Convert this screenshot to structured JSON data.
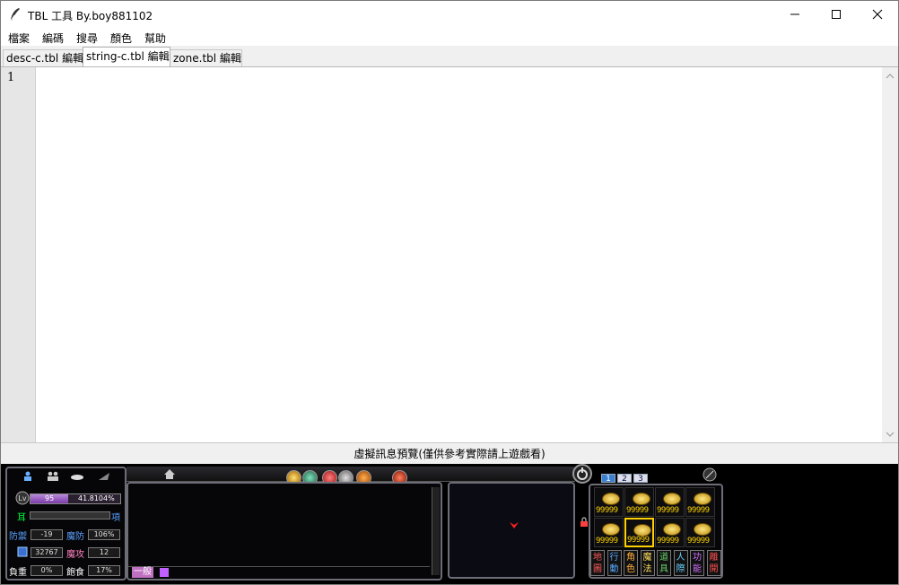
{
  "window": {
    "title": "TBL 工具 By.boy881102"
  },
  "menu": {
    "items": [
      "檔案",
      "編碼",
      "搜尋",
      "顏色",
      "幫助"
    ]
  },
  "tabs": [
    {
      "label": "desc-c.tbl 編輯",
      "active": false
    },
    {
      "label": "string-c.tbl 編輯",
      "active": true
    },
    {
      "label": "zone.tbl 編輯",
      "active": false
    }
  ],
  "editor": {
    "line_numbers": [
      "1"
    ],
    "content": ""
  },
  "preview": {
    "label": "虛擬訊息預覽(僅供參考實際請上遊戲看)"
  },
  "game_ui": {
    "stats": {
      "level": "95",
      "exp_percent": "41.8104%",
      "exp_fill_fraction": 0.42,
      "ear_label": "耳",
      "item_label": "項",
      "defense_label": "防禦",
      "defense_value": "-19",
      "magic_def_label": "魔防",
      "magic_def_value": "106%",
      "mp_value": "32767",
      "magic_atk_label": "魔攻",
      "magic_atk_value": "12",
      "weight_label": "負重",
      "weight_value": "0%",
      "food_label": "飽食",
      "food_value": "17%"
    },
    "chat": {
      "channel_label": "一般"
    },
    "slot_pages": [
      "1",
      "2",
      "3"
    ],
    "coin_slots": [
      "99999",
      "99999",
      "99999",
      "99999",
      "99999",
      "99999",
      "99999",
      "99999"
    ],
    "func_buttons": [
      {
        "top": "地",
        "bottom": "圖",
        "color": "#ff5a5a"
      },
      {
        "top": "行",
        "bottom": "動",
        "color": "#5aa8ff"
      },
      {
        "top": "角",
        "bottom": "色",
        "color": "#ffb040"
      },
      {
        "top": "魔",
        "bottom": "法",
        "color": "#ffe060"
      },
      {
        "top": "道",
        "bottom": "具",
        "color": "#6ad06a"
      },
      {
        "top": "人",
        "bottom": "際",
        "color": "#6ad0ff"
      },
      {
        "top": "功",
        "bottom": "能",
        "color": "#d070ff"
      },
      {
        "top": "離",
        "bottom": "開",
        "color": "#ff5050"
      }
    ],
    "colors": {
      "green_label": "#00ff40",
      "blue_label": "#5aa0ff",
      "pink_label": "#ff80c0",
      "gold": "#ffd400",
      "map_marker": "#ff2020"
    }
  }
}
